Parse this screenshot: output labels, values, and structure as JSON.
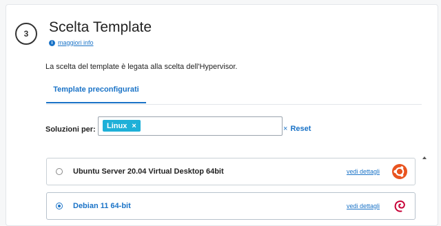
{
  "step": {
    "number": "3",
    "title": "Scelta Template",
    "info_link": "maggiori info"
  },
  "description": "La scelta del template è legata alla scelta dell'Hypervisor.",
  "tabs": [
    {
      "label": "Template preconfigurati",
      "active": true
    }
  ],
  "filter": {
    "label": "Soluzioni per:",
    "chips": [
      {
        "label": "Linux",
        "remove_icon": "×"
      }
    ],
    "reset_label": "Reset",
    "reset_icon": "×"
  },
  "templates": [
    {
      "name": "Ubuntu Server 20.04 Virtual Desktop 64bit",
      "details_link": "vedi dettagli",
      "icon": "ubuntu-icon",
      "selected": false
    },
    {
      "name": "Debian 11 64-bit",
      "details_link": "vedi dettagli",
      "icon": "debian-icon",
      "selected": true
    }
  ],
  "colors": {
    "accent": "#1a73c7",
    "chip": "#1eb0d8",
    "ubuntu": "#e95420",
    "debian": "#c70036"
  }
}
